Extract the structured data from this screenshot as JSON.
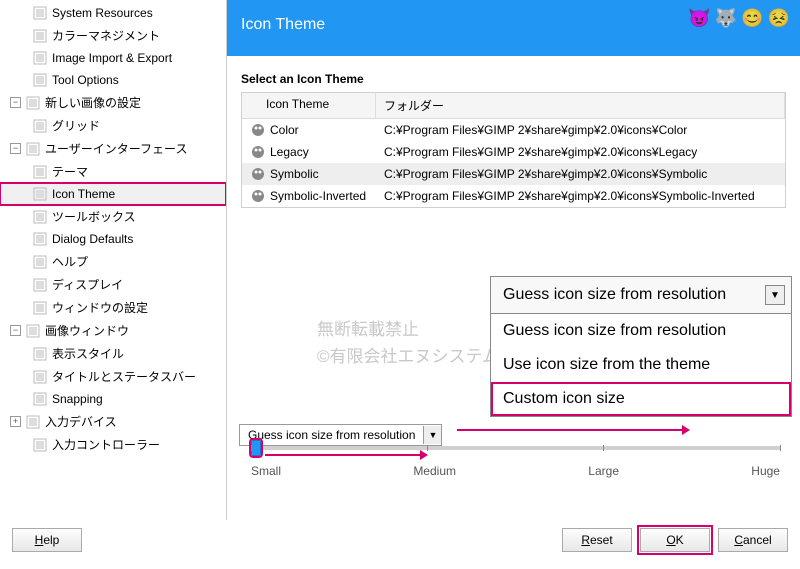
{
  "header": {
    "title": "Icon Theme"
  },
  "sidebar": {
    "items": [
      {
        "label": "System Resources",
        "indent": 2
      },
      {
        "label": "カラーマネジメント",
        "indent": 2
      },
      {
        "label": "Image Import & Export",
        "indent": 2
      },
      {
        "label": "Tool Options",
        "indent": 2
      },
      {
        "label": "新しい画像の設定",
        "indent": 1,
        "expander": "−"
      },
      {
        "label": "グリッド",
        "indent": 2
      },
      {
        "label": "ユーザーインターフェース",
        "indent": 1,
        "expander": "−"
      },
      {
        "label": "テーマ",
        "indent": 2
      },
      {
        "label": "Icon Theme",
        "indent": 2,
        "selected": true,
        "hl": true
      },
      {
        "label": "ツールボックス",
        "indent": 2
      },
      {
        "label": "Dialog Defaults",
        "indent": 2
      },
      {
        "label": "ヘルプ",
        "indent": 2
      },
      {
        "label": "ディスプレイ",
        "indent": 2
      },
      {
        "label": "ウィンドウの設定",
        "indent": 2
      },
      {
        "label": "画像ウィンドウ",
        "indent": 1,
        "expander": "−"
      },
      {
        "label": "表示スタイル",
        "indent": 2
      },
      {
        "label": "タイトルとステータスバー",
        "indent": 2
      },
      {
        "label": "Snapping",
        "indent": 2
      },
      {
        "label": "入力デバイス",
        "indent": 1,
        "expander": "+"
      },
      {
        "label": "入力コントローラー",
        "indent": 2
      }
    ]
  },
  "table": {
    "section_label": "Select an Icon Theme",
    "headers": {
      "col1": "Icon Theme",
      "col2": "フォルダー"
    },
    "rows": [
      {
        "name": "Color",
        "path": "C:¥Program Files¥GIMP 2¥share¥gimp¥2.0¥icons¥Color"
      },
      {
        "name": "Legacy",
        "path": "C:¥Program Files¥GIMP 2¥share¥gimp¥2.0¥icons¥Legacy"
      },
      {
        "name": "Symbolic",
        "path": "C:¥Program Files¥GIMP 2¥share¥gimp¥2.0¥icons¥Symbolic",
        "sel": true
      },
      {
        "name": "Symbolic-Inverted",
        "path": "C:¥Program Files¥GIMP 2¥share¥gimp¥2.0¥icons¥Symbolic-Inverted"
      }
    ]
  },
  "watermark": {
    "line1": "無断転載禁止",
    "line2": "©有限会社エヌシステム"
  },
  "dropdown": {
    "selected": "Guess icon size from resolution",
    "options": [
      "Guess icon size from resolution",
      "Use icon size from the theme",
      "Custom icon size"
    ]
  },
  "combo": {
    "label": "Guess icon size from resolution"
  },
  "slider": {
    "labels": [
      "Small",
      "Medium",
      "Large",
      "Huge"
    ]
  },
  "buttons": {
    "help": "Help",
    "reset": "Reset",
    "ok": "OK",
    "cancel": "Cancel"
  }
}
